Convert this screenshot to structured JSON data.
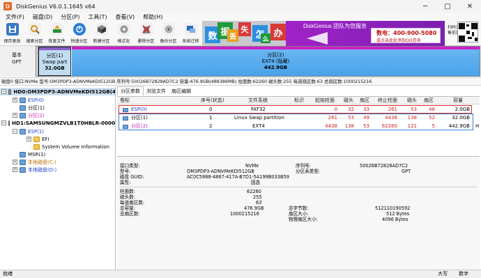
{
  "window": {
    "title": "DiskGenius V6.0.1.1645 x64",
    "app_icon": "D",
    "controls": [
      "─",
      "□",
      "✕"
    ]
  },
  "menu": [
    "文件(F)",
    "磁盘(D)",
    "分区(P)",
    "工具(T)",
    "查看(V)",
    "帮助(H)"
  ],
  "toolbar": {
    "tools": [
      {
        "label": "保存更改",
        "icon": "save-icon",
        "color": "#3a78c8"
      },
      {
        "label": "搜索分区",
        "icon": "search-icon",
        "color": "#d89020"
      },
      {
        "label": "恢复文件",
        "icon": "recover-icon",
        "color": "#2f8c3a"
      },
      {
        "label": "快速分区",
        "icon": "quick-partition-icon",
        "color": "#2b7fd6"
      },
      {
        "label": "新建分区",
        "icon": "new-partition-icon",
        "color": "#555555"
      },
      {
        "label": "格式化",
        "icon": "format-icon",
        "color": "#666666"
      },
      {
        "label": "删除分区",
        "icon": "delete-icon",
        "color": "#c03030"
      },
      {
        "label": "备份分区",
        "icon": "backup-icon",
        "color": "#707070"
      },
      {
        "label": "系统迁移",
        "icon": "migrate-icon",
        "color": "#2b6cc0"
      }
    ]
  },
  "banner": {
    "tiles": [
      {
        "char": "数",
        "color": "#2a8fe0"
      },
      {
        "char": "据",
        "color": "#1f9a3a"
      },
      {
        "char": "丢",
        "color": "#e8a020"
      },
      {
        "char": "失",
        "color": "#d83a3a"
      },
      {
        "char": "怎",
        "color": "#2a8fe0"
      },
      {
        "char": "么",
        "color": "#1f9a3a"
      },
      {
        "char": "办",
        "color": "#d83a3a"
      }
    ],
    "brand": "DiskGenius 团队为您服务",
    "hotline": "数电：400-900-5080",
    "qq": "或点击此处添加QQ咨询",
    "qr_label": [
      "扫码咨询",
      "售前客服"
    ]
  },
  "diskmap": {
    "type_label": [
      "基本",
      "GPT"
    ],
    "swap": {
      "name": "分区(1)",
      "fs": "Swap part",
      "size": "32.0GB"
    },
    "ext4": {
      "name": "分区(2)",
      "fs": "EXT4 (隐藏)",
      "size": "442.9GB"
    }
  },
  "diskinfo": "磁盘0 接口:NVMe  型号:OM3PDP3-ADNVMeKDI512GB  序列号:50026B72828AD7C2  容量:476.9GB(488386MB)  柱面数:62260  磁头数:255  每道扇区数:63  总扇区数:1000215216",
  "tree": {
    "disk0": {
      "label": "HD0:OM3PDP3-ADNVMeKDI512GB(4",
      "children": [
        "ESP(0)",
        "分区(1)",
        "分区(2)"
      ]
    },
    "disk1": {
      "label": "HD1:SAMSUNGMZVLB1T0HBLR-0000(",
      "children": [
        "ESP(1)",
        "EFI",
        "System Volume Information",
        "MSR(1)",
        "本地磁盘(C:)",
        "本地磁盘(D:)"
      ]
    }
  },
  "tabs": [
    "分区参数",
    "浏览文件",
    "扇区编辑"
  ],
  "partition_table": {
    "columns": [
      "卷标",
      "序号(状态)",
      "文件系统",
      "标识",
      "起始柱面",
      "磁头",
      "扇区",
      "终止柱面",
      "磁头",
      "扇区",
      "容量"
    ],
    "rows": [
      {
        "label": "ESP(0)",
        "index": "0",
        "fs": "FAT32",
        "flag": "",
        "start_cyl": "0",
        "start_head": "32",
        "start_sec": "33",
        "end_cyl": "261",
        "end_head": "53",
        "end_sec": "48",
        "size": "2.0GB"
      },
      {
        "label": "分区(1)",
        "index": "1",
        "fs": "Linux Swap partition",
        "flag": "",
        "start_cyl": "261",
        "start_head": "53",
        "start_sec": "49",
        "end_cyl": "4438",
        "end_head": "138",
        "end_sec": "52",
        "size": "32.0GB"
      },
      {
        "label": "分区(2)",
        "index": "2",
        "fs": "EXT4",
        "flag": "",
        "start_cyl": "4438",
        "start_head": "138",
        "start_sec": "53",
        "end_cyl": "62260",
        "end_head": "121",
        "end_sec": "5",
        "size": "442.9GB",
        "trailing": "H"
      }
    ]
  },
  "details": {
    "interface_label": "接口类型:",
    "interface": "NVMe",
    "serial_label": "序列号:",
    "serial": "50026B72828AD7C2",
    "model_label": "型号:",
    "model": "OM3PDP3-ADNVMeKDI512GB",
    "ptable_label": "分区表类型:",
    "ptable": "GPT",
    "guid_label": "磁盘 GUID:",
    "guid": "AC0C5888-4867-417A-B7D1-5A199B033B59",
    "attr_label": "属性:",
    "attr": "固态",
    "cyl_label": "柱面数:",
    "cyl": "62260",
    "heads_label": "磁头数:",
    "heads": "255",
    "spt_label": "每道扇区数:",
    "spt": "63",
    "capacity_label": "总容量:",
    "capacity": "476.9GB",
    "total_bytes_label": "总字节数:",
    "total_bytes": "512110190592",
    "total_sectors_label": "总扇区数:",
    "total_sectors": "1000215216",
    "sector_size_label": "扇区大小:",
    "sector_size": "512 Bytes",
    "phys_sector_label": "物理扇区大小:",
    "phys_sector": "4096 Bytes"
  },
  "status": {
    "left": "就绪",
    "caps": "大写",
    "num": "数字"
  }
}
